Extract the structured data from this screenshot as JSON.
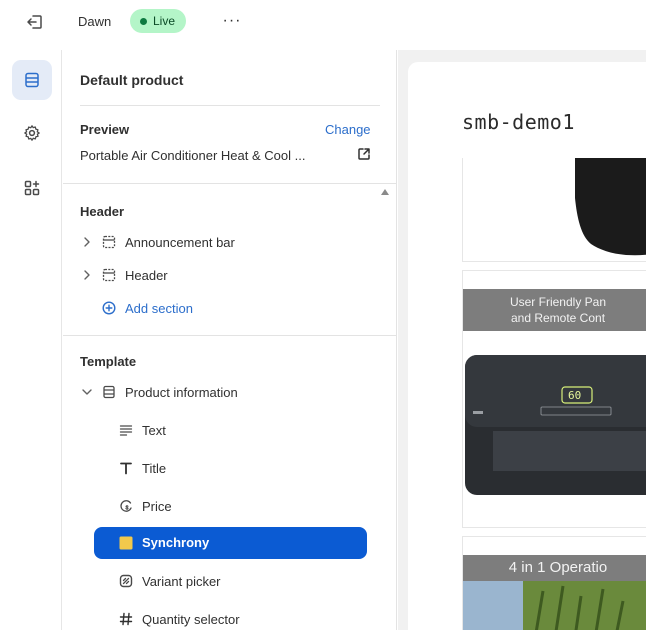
{
  "topbar": {
    "theme_name": "Dawn",
    "status_badge": "Live",
    "more_label": "···"
  },
  "rail": {
    "items": [
      {
        "icon": "sections-icon",
        "active": true
      },
      {
        "icon": "settings-gear-icon",
        "active": false
      },
      {
        "icon": "apps-icon",
        "active": false
      }
    ]
  },
  "panel": {
    "title": "Default product",
    "preview": {
      "label": "Preview",
      "change_label": "Change",
      "value": "Portable Air Conditioner Heat & Cool ..."
    },
    "header_group": {
      "title": "Header",
      "items": [
        {
          "label": "Announcement bar",
          "icon": "section-icon"
        },
        {
          "label": "Header",
          "icon": "section-icon"
        }
      ],
      "add_section_label": "Add section"
    },
    "template_group": {
      "title": "Template",
      "section_label": "Product information",
      "blocks": [
        {
          "label": "Text",
          "icon": "text-lines-icon"
        },
        {
          "label": "Title",
          "icon": "title-t-icon"
        },
        {
          "label": "Price",
          "icon": "price-tag-icon"
        },
        {
          "label": "Synchrony",
          "icon": "app-block-icon",
          "selected": true
        },
        {
          "label": "Variant picker",
          "icon": "variant-picker-icon"
        },
        {
          "label": "Quantity selector",
          "icon": "hash-icon"
        }
      ]
    }
  },
  "canvas": {
    "store_name": "smb-demo1",
    "banner_1_line_1": "User Friendly Pan",
    "banner_1_line_2": "and Remote Cont",
    "banner_2": "4 in 1 Operatio",
    "device_display": "60"
  },
  "colors": {
    "accent": "#0b5bd3",
    "link": "#2c6ecb",
    "live_badge": "#b4f5c8",
    "live_dot": "#0e7a41"
  }
}
